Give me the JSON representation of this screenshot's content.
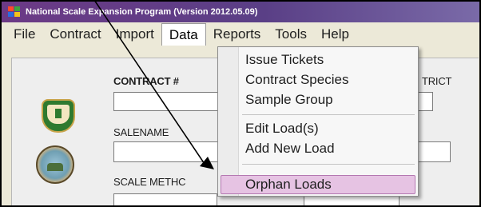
{
  "window": {
    "title": "National Scale Expansion Program (Version 2012.05.09)"
  },
  "menubar": {
    "items": [
      "File",
      "Contract",
      "Import",
      "Data",
      "Reports",
      "Tools",
      "Help"
    ],
    "active": "Data"
  },
  "form": {
    "contract_label": "CONTRACT #",
    "district_label": "TRICT",
    "salename_label": "SALENAME",
    "scale_method_label": "SCALE METHC"
  },
  "data_menu": {
    "items": [
      "Issue Tickets",
      "Contract Species",
      "Sample Group",
      "Edit Load(s)",
      "Add New Load",
      "Orphan Loads"
    ],
    "highlighted": "Orphan Loads",
    "highlight_color": "#e6c3e3"
  },
  "logos": {
    "forest_service": "forest-service-shield-icon",
    "seal": "agency-seal-icon"
  }
}
